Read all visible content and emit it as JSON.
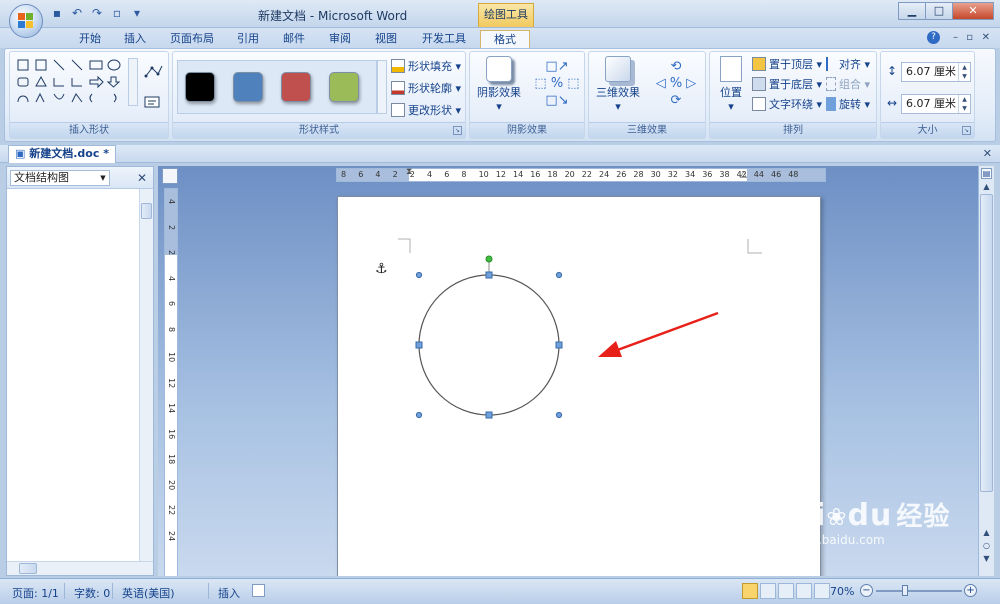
{
  "window": {
    "title": "新建文档 - Microsoft Word",
    "contextual_tab_group": "绘图工具"
  },
  "ribbon_tabs": [
    {
      "label": "开始",
      "active": false
    },
    {
      "label": "插入",
      "active": false
    },
    {
      "label": "页面布局",
      "active": false
    },
    {
      "label": "引用",
      "active": false
    },
    {
      "label": "邮件",
      "active": false
    },
    {
      "label": "审阅",
      "active": false
    },
    {
      "label": "视图",
      "active": false
    },
    {
      "label": "开发工具",
      "active": false
    },
    {
      "label": "格式",
      "active": true
    }
  ],
  "groups": {
    "insert_shapes": {
      "label": "插入形状"
    },
    "shape_styles": {
      "label": "形状样式",
      "swatch_colors": [
        "#000000",
        "#4f81bd",
        "#c0504d",
        "#9bbb59"
      ],
      "fill_label": "形状填充",
      "outline_label": "形状轮廓",
      "change_shape_label": "更改形状"
    },
    "shadow_effects": {
      "label": "阴影效果",
      "button_label": "阴影效果"
    },
    "three_d_effects": {
      "label": "三维效果",
      "button_label": "三维效果"
    },
    "arrange": {
      "label": "排列",
      "position_label": "位置",
      "bring_front_label": "置于顶层",
      "send_back_label": "置于底层",
      "wrap_text_label": "文字环绕",
      "align_label": "对齐",
      "group_label": "组合",
      "rotate_label": "旋转"
    },
    "size": {
      "label": "大小",
      "height_value": "6.07 厘米",
      "width_value": "6.07 厘米"
    }
  },
  "document_tab": {
    "label": "新建文档.doc *"
  },
  "nav_pane": {
    "selector_value": "文档结构图"
  },
  "ruler": {
    "horizontal_ticks": [
      "8",
      "6",
      "4",
      "2",
      "2",
      "4",
      "6",
      "8",
      "10",
      "12",
      "14",
      "16",
      "18",
      "20",
      "22",
      "24",
      "26",
      "28",
      "30",
      "32",
      "34",
      "36",
      "38",
      "42",
      "44",
      "46",
      "48"
    ],
    "vertical_ticks": [
      "4",
      "2",
      "2",
      "4",
      "6",
      "8",
      "10",
      "12",
      "14",
      "16",
      "18",
      "20",
      "22",
      "24"
    ]
  },
  "status": {
    "page": "页面: 1/1",
    "words": "字数: 0",
    "language": "英语(美国)",
    "mode": "插入",
    "zoom": "70%"
  },
  "watermark": {
    "brand": "Bai",
    "brand2": "du",
    "cn": "经验",
    "url": "jingyan.baidu.com"
  },
  "colors": {
    "selection_handle": "#4f81bd",
    "rotate_handle": "#3fbf3f",
    "arrow": "#e8201a"
  }
}
